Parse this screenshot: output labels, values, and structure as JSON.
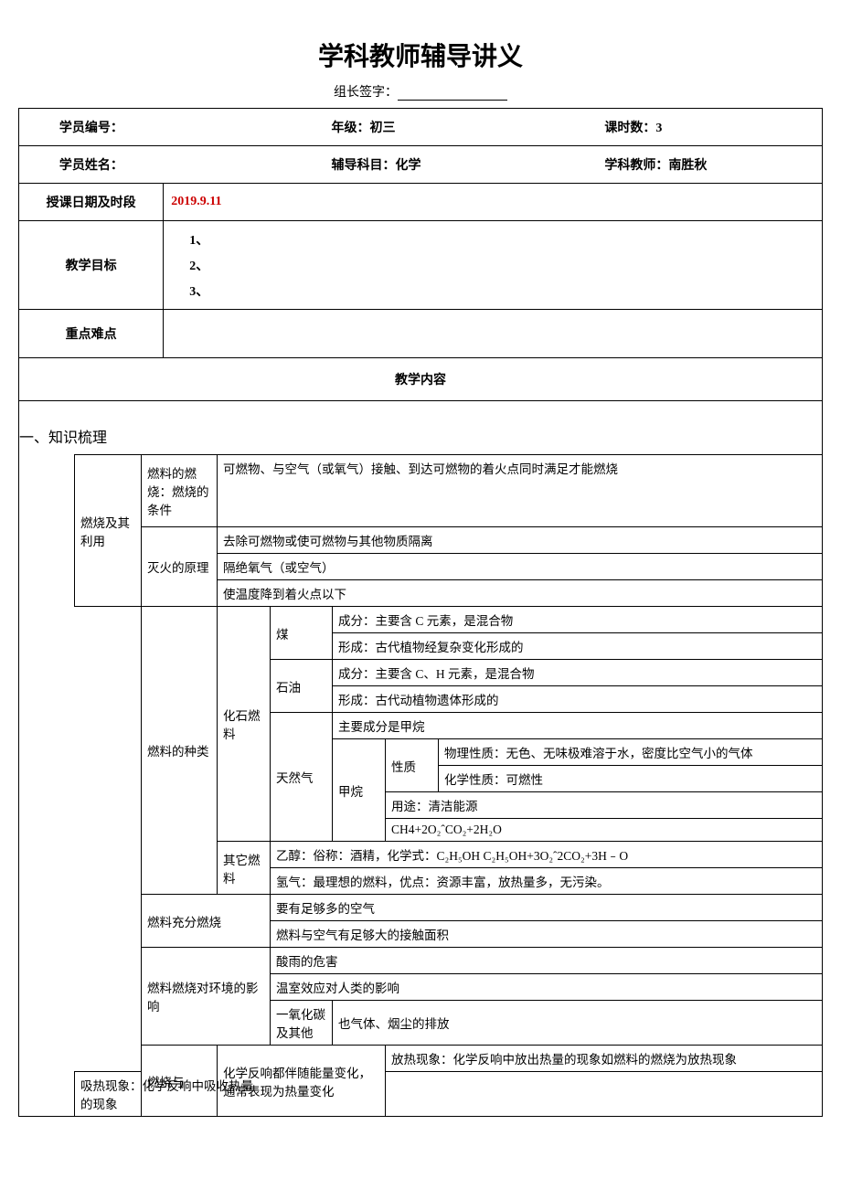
{
  "title": "学科教师辅导讲义",
  "signature_label": "组长签字：",
  "header": {
    "student_id_label": "学员编号：",
    "grade_label": "年级：",
    "grade_value": "初三",
    "hours_label": "课时数：",
    "hours_value": "3",
    "student_name_label": "学员姓名：",
    "subject_label": "辅导科目：",
    "subject_value": "化学",
    "teacher_label": "学科教师：",
    "teacher_value": "南胜秋",
    "date_label": "授课日期及时段",
    "date_value": "2019.9.11",
    "goal_label": "教学目标",
    "goal_1": "1、",
    "goal_2": "2、",
    "goal_3": "3、",
    "keypoint_label": "重点难点",
    "content_header": "教学内容"
  },
  "section1_title": "一、知识梳理",
  "knowledge": {
    "lvl1_combustion": "燃烧及其利用",
    "combustion_conditions_label": "燃料的燃烧：燃烧的条件",
    "combustion_conditions_text": "可燃物、与空气（或氧气）接触、到达可燃物的着火点同时满足才能燃烧",
    "fire_principle_label": "灭火的原理",
    "fire_principle_1": "去除可燃物或使可燃物与其他物质隔离",
    "fire_principle_2": "隔绝氧气（或空气）",
    "fire_principle_3": "使温度降到着火点以下",
    "fuel_types_label": "燃料的种类",
    "fossil_fuel_label": "化石燃料",
    "coal_label": "煤",
    "coal_comp": "成分：主要含 C 元素，是混合物",
    "coal_form": "形成：古代植物经复杂变化形成的",
    "oil_label": "石油",
    "oil_comp": "成分：主要含 C、H 元素，是混合物",
    "oil_form": "形成：古代动植物遗体形成的",
    "natgas_label": "天然气",
    "natgas_main": "主要成分是甲烷",
    "methane_label": "甲烷",
    "property_label": "性质",
    "methane_phys": "物理性质：无色、无味极难溶于水，密度比空气小的气体",
    "methane_chem": "化学性质：可燃性",
    "methane_use": "用途：清洁能源",
    "methane_eq": "CH4+2O₂ˆCO₂+2H₂O",
    "other_fuel_label": "其它燃料",
    "ethanol": "乙醇：俗称：酒精，化学式：C₂H₅OH      C₂H₅OH+3O₂ˆ2CO₂+3H﹣O",
    "hydrogen": "氢气：最理想的燃料，优点：资源丰富，放热量多，无污染。",
    "full_burn_label": "燃料充分燃烧",
    "full_burn_1": "要有足够多的空气",
    "full_burn_2": "燃料与空气有足够大的接触面积",
    "env_label": "燃料燃烧对环境的影响",
    "env_1": "酸雨的危害",
    "env_2": "温室效应对人类的影响",
    "env_3a": "一氧化碳及其他",
    "env_3b": "也气体、烟尘的排放",
    "energy_label_1": "燃烧与",
    "energy_text_1": "化学反响都伴随能量变化，通常表现为热量变化",
    "exo": "放热现象：化学反响中放出热量的现象如燃料的燃烧为放热现象",
    "endo": "吸热现象：化学反响中吸收热量的现象"
  }
}
